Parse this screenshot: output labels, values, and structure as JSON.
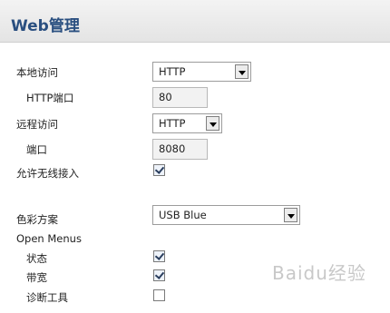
{
  "header": {
    "title": "Web管理"
  },
  "local_access": {
    "label": "本地访问",
    "value": "HTTP"
  },
  "http_port": {
    "label": "HTTP端口",
    "value": "80"
  },
  "remote_access": {
    "label": "远程访问",
    "value": "HTTP"
  },
  "remote_port": {
    "label": "端口",
    "value": "8080"
  },
  "wireless": {
    "label": "允许无线接入",
    "checked": true
  },
  "color_scheme": {
    "label": "色彩方案",
    "value": "USB Blue"
  },
  "open_menus": {
    "label": "Open Menus",
    "items": [
      {
        "label": "状态",
        "checked": true
      },
      {
        "label": "带宽",
        "checked": true
      },
      {
        "label": "诊断工具",
        "checked": false
      }
    ]
  },
  "watermark": "Baidu经验"
}
